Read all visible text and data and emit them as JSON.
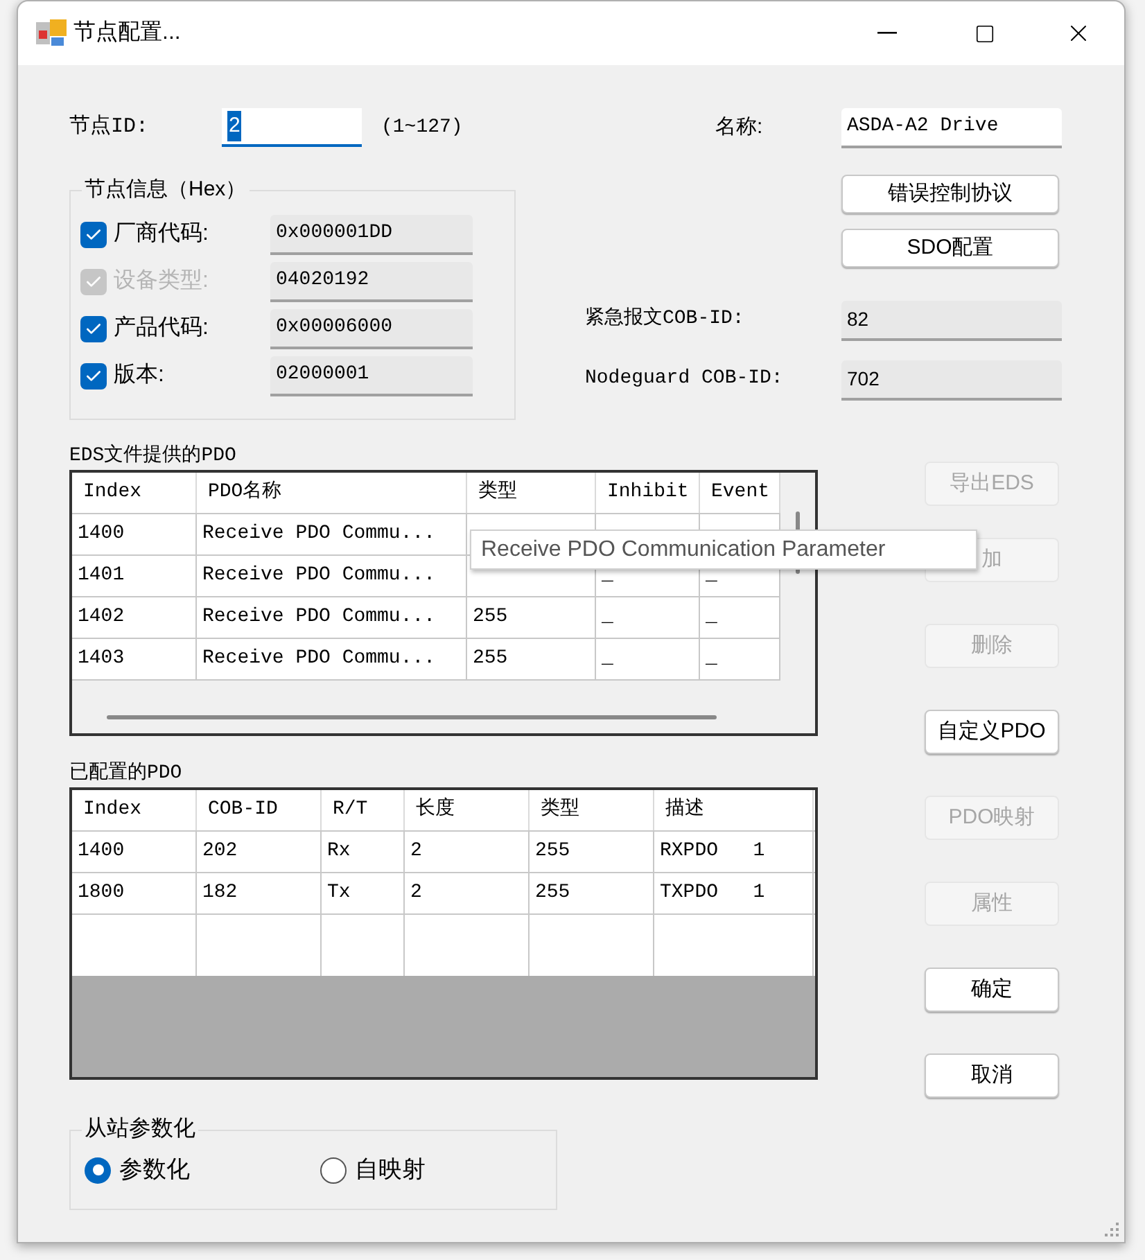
{
  "window": {
    "title": "节点配置..."
  },
  "node_id": {
    "label": "节点ID:",
    "value": "2",
    "range": "(1~127)"
  },
  "name": {
    "label": "名称:",
    "value": "ASDA-A2 Drive"
  },
  "node_info": {
    "title": "节点信息（Hex）",
    "items": [
      {
        "label": "厂商代码:",
        "value": "0x000001DD",
        "checked": true,
        "disabled": false
      },
      {
        "label": "设备类型:",
        "value": "04020192",
        "checked": true,
        "disabled": true
      },
      {
        "label": "产品代码:",
        "value": "0x00006000",
        "checked": true,
        "disabled": false
      },
      {
        "label": "版本:",
        "value": "02000001",
        "checked": true,
        "disabled": false
      }
    ]
  },
  "protocol_buttons": [
    {
      "label": "错误控制协议",
      "disabled": false
    },
    {
      "label": "SDO配置",
      "disabled": false
    }
  ],
  "cob_fields": [
    {
      "label": "紧急报文COB-ID:",
      "value": "82"
    },
    {
      "label": "Nodeguard COB-ID:",
      "value": "702"
    }
  ],
  "eds_pdo": {
    "title": "EDS文件提供的PDO",
    "columns": [
      "Index",
      "PDO名称",
      "类型",
      "Inhibit",
      "Event"
    ],
    "rows": [
      [
        "1400",
        "Receive PDO Commu...",
        null,
        null,
        null
      ],
      [
        "1401",
        "Receive PDO Commu...",
        null,
        "_",
        "_"
      ],
      [
        "1402",
        "Receive PDO Commu...",
        "255",
        "_",
        "_"
      ],
      [
        "1403",
        "Receive PDO Commu...",
        "255",
        "_",
        "_"
      ]
    ]
  },
  "tooltip": "Receive PDO Communication Parameter",
  "configured_pdo": {
    "title": "已配置的PDO",
    "columns": [
      "Index",
      "COB-ID",
      "R/T",
      "长度",
      "类型",
      "描述"
    ],
    "rows": [
      [
        "1400",
        "202",
        "Rx",
        "2",
        "255",
        "RXPDO   1"
      ],
      [
        "1800",
        "182",
        "Tx",
        "2",
        "255",
        "TXPDO   1"
      ]
    ]
  },
  "side_buttons": [
    {
      "label": "导出EDS",
      "disabled": true
    },
    {
      "label": "加",
      "disabled": true
    },
    {
      "label": "删除",
      "disabled": true
    },
    {
      "label": "自定义PDO",
      "disabled": false
    },
    {
      "label": "PDO映射",
      "disabled": true
    },
    {
      "label": "属性",
      "disabled": true
    },
    {
      "label": "确定",
      "disabled": false
    },
    {
      "label": "取消",
      "disabled": false
    }
  ],
  "slave_param": {
    "title": "从站参数化",
    "options": [
      {
        "label": "参数化",
        "selected": true
      },
      {
        "label": "自映射",
        "selected": false
      }
    ]
  }
}
